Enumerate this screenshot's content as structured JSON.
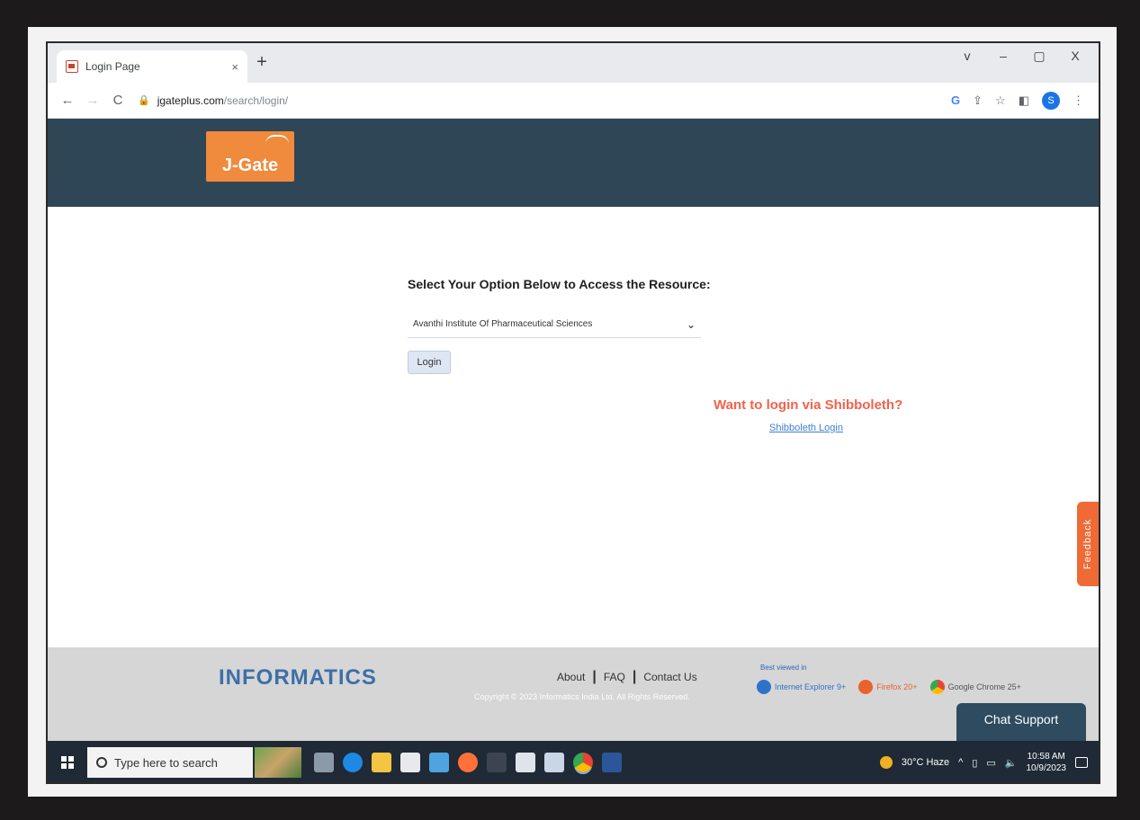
{
  "browser": {
    "tab_title": "Login Page",
    "tab_close": "×",
    "new_tab": "+",
    "window_controls": {
      "tab_search": "v",
      "minimize": "–",
      "restore": "▢",
      "close": "X"
    },
    "url_domain": "jgateplus.com",
    "url_path": "/search/login/",
    "profile_initial": "S"
  },
  "header": {
    "logo_text": "J-Gate"
  },
  "login": {
    "title": "Select Your Option Below to Access the Resource:",
    "selected_institution": "Avanthi Institute Of Pharmaceutical Sciences",
    "login_button": "Login",
    "shibboleth_title": "Want to login via Shibboleth?",
    "shibboleth_link": "Shibboleth Login",
    "feedback": "Feedback"
  },
  "footer": {
    "logo_text": "INFORMATICS",
    "links": [
      "About",
      "FAQ",
      "Contact Us"
    ],
    "copyright": "Copyright © 2023 Informatics India Ltd. All Rights Reserved.",
    "best_viewed_label": "Best viewed in",
    "browsers": [
      "Internet Explorer 9+",
      "Firefox 20+",
      "Google Chrome 25+"
    ],
    "chat_support": "Chat Support"
  },
  "taskbar": {
    "search_placeholder": "Type here to search",
    "weather": "30°C Haze",
    "time": "10:58 AM",
    "date": "10/9/2023"
  },
  "colors": {
    "header_bg": "#2f4656",
    "logo_bg": "#f08a3c",
    "shibboleth_title": "#f2624a",
    "link": "#3f7fd0",
    "feedback_bg": "#f06a36",
    "chat_bg": "#2e4b5f"
  }
}
